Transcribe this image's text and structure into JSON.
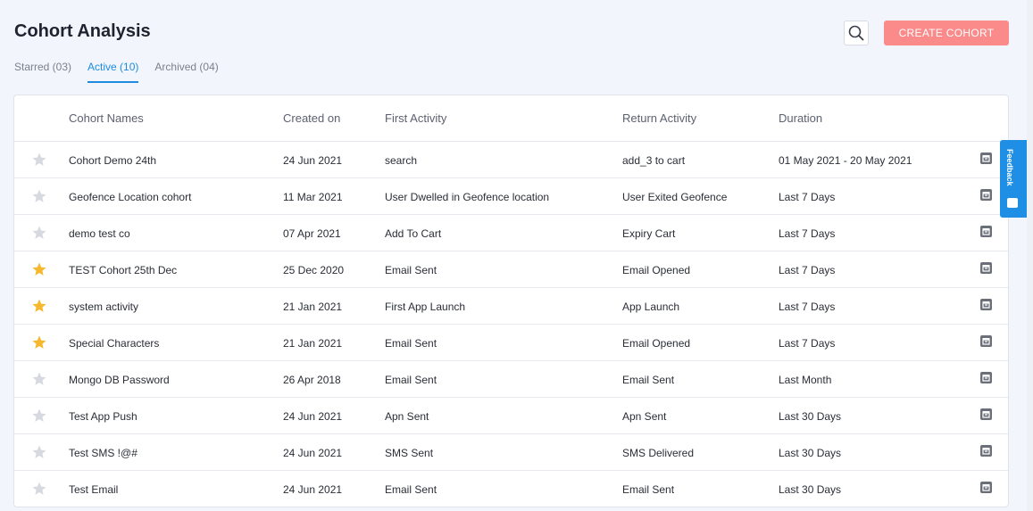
{
  "page": {
    "title": "Cohort Analysis"
  },
  "tabs": [
    {
      "label": "Starred (03)",
      "active": false
    },
    {
      "label": "Active (10)",
      "active": true
    },
    {
      "label": "Archived (04)",
      "active": false
    }
  ],
  "toolbar": {
    "search_icon": "search-icon",
    "create_label": "CREATE COHORT"
  },
  "table": {
    "headers": {
      "name": "Cohort Names",
      "created": "Created on",
      "first": "First Activity",
      "return": "Return Activity",
      "duration": "Duration"
    },
    "rows": [
      {
        "starred": false,
        "name": "Cohort Demo 24th",
        "created": "24 Jun 2021",
        "first": "search",
        "return": "add_3 to cart",
        "duration": "01 May 2021 - 20 May 2021"
      },
      {
        "starred": false,
        "name": "Geofence Location cohort",
        "created": "11 Mar 2021",
        "first": "User Dwelled in Geofence location",
        "return": "User Exited Geofence",
        "duration": "Last 7 Days"
      },
      {
        "starred": false,
        "name": "demo test co",
        "created": "07 Apr 2021",
        "first": "Add To Cart",
        "return": "Expiry Cart",
        "duration": "Last 7 Days"
      },
      {
        "starred": true,
        "name": "TEST Cohort 25th Dec",
        "created": "25 Dec 2020",
        "first": "Email Sent",
        "return": "Email Opened",
        "duration": "Last 7 Days"
      },
      {
        "starred": true,
        "name": "system activity",
        "created": "21 Jan 2021",
        "first": "First App Launch",
        "return": "App Launch",
        "duration": "Last 7 Days"
      },
      {
        "starred": true,
        "name": "Special Characters",
        "created": "21 Jan 2021",
        "first": "Email Sent",
        "return": "Email Opened",
        "duration": "Last 7 Days"
      },
      {
        "starred": false,
        "name": "Mongo DB Password",
        "created": "26 Apr 2018",
        "first": "Email Sent",
        "return": "Email Sent",
        "duration": "Last Month"
      },
      {
        "starred": false,
        "name": "Test App Push",
        "created": "24 Jun 2021",
        "first": "Apn Sent",
        "return": "Apn Sent",
        "duration": "Last 30 Days"
      },
      {
        "starred": false,
        "name": "Test SMS !@#",
        "created": "24 Jun 2021",
        "first": "SMS Sent",
        "return": "SMS Delivered",
        "duration": "Last 30 Days"
      },
      {
        "starred": false,
        "name": "Test Email",
        "created": "24 Jun 2021",
        "first": "Email Sent",
        "return": "Email Sent",
        "duration": "Last 30 Days"
      }
    ]
  },
  "feedback": {
    "label": "Feedback"
  },
  "colors": {
    "accent": "#1d8be0",
    "create_button": "#fb8a8a",
    "star_on": "#f5b82e",
    "star_off": "#d6d9e0"
  }
}
